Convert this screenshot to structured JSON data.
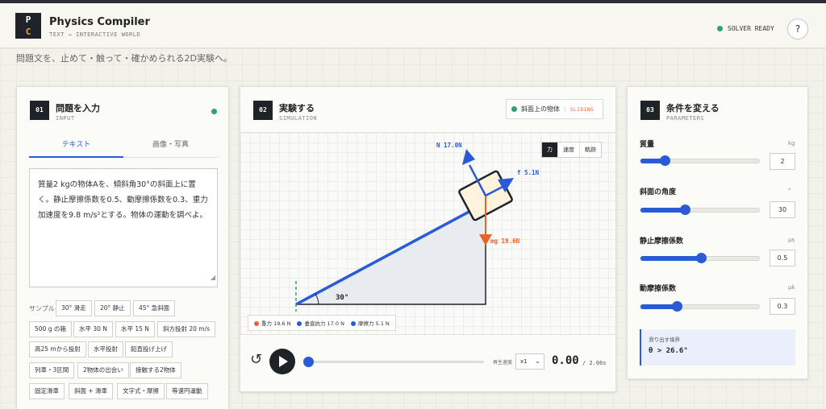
{
  "app": {
    "logo_top": "P",
    "logo_bottom": "C",
    "title": "Physics Compiler",
    "subtitle": "TEXT → INTERACTIVE WORLD",
    "solver_status": "SOLVER READY",
    "help": "?",
    "tagline": "問題文を、止めて・触って・確かめられる2D実験へ。"
  },
  "input_panel": {
    "num": "01",
    "title": "問題を入力",
    "subtitle": "INPUT",
    "tabs": [
      "テキスト",
      "画像・写真"
    ],
    "problem_text": "質量2 kgの物体Aを、傾斜角30°の斜面上に置く。静止摩擦係数を0.5、動摩擦係数を0.3、重力加速度を9.8 m/s²とする。物体の運動を調べよ。",
    "samples_label": "サンプル",
    "samples": [
      "30° 滑走",
      "20° 静止",
      "45° 急斜面",
      "500 g の箱",
      "水平 30 N",
      "水平 15 N",
      "斜方投射 20 m/s",
      "高25 mから投射",
      "水平投射",
      "鉛直投げ上げ",
      "列車・3区間",
      "2物体の出会い",
      "接触する2物体",
      "固定滑車",
      "斜面 + 滑車",
      "文字式・摩擦",
      "等速円運動"
    ]
  },
  "sim_panel": {
    "num": "02",
    "title": "実験する",
    "subtitle": "SIMULATION",
    "status_label": "斜面上の物体",
    "status_state": "SLIDING",
    "view_toggle": [
      "力",
      "速度",
      "軌跡"
    ],
    "angle_label": "30°",
    "force_normal_label": "N 17.0N",
    "force_friction_label": "f 5.1N",
    "force_gravity_label": "mg 19.6N",
    "legend": [
      {
        "label": "重力 19.6 N",
        "color": "#e8632c"
      },
      {
        "label": "垂直抗力 17.0 N",
        "color": "#2a5bd7"
      },
      {
        "label": "摩擦力 5.1 N",
        "color": "#2a5bd7"
      }
    ],
    "reset_icon": "↺",
    "speed_label": "再生速度",
    "speed_value": "x1",
    "time": "0.00",
    "duration": "/ 2.06s",
    "progress": 0
  },
  "params_panel": {
    "num": "03",
    "title": "条件を変える",
    "subtitle": "PARAMETERS",
    "params": [
      {
        "label": "質量",
        "unit": "kg",
        "value": "2",
        "fraction": 0.2
      },
      {
        "label": "斜面の角度",
        "unit": "°",
        "value": "30",
        "fraction": 0.37
      },
      {
        "label": "静止摩擦係数",
        "unit": "μs",
        "value": "0.5",
        "fraction": 0.5
      },
      {
        "label": "動摩擦係数",
        "unit": "μk",
        "value": "0.3",
        "fraction": 0.3
      }
    ],
    "threshold_title": "滑り出す境界",
    "threshold_value": "θ > 26.6°"
  },
  "colors": {
    "accent": "#2a5bd7",
    "gravity": "#e8632c",
    "ready": "#2ea36b"
  }
}
